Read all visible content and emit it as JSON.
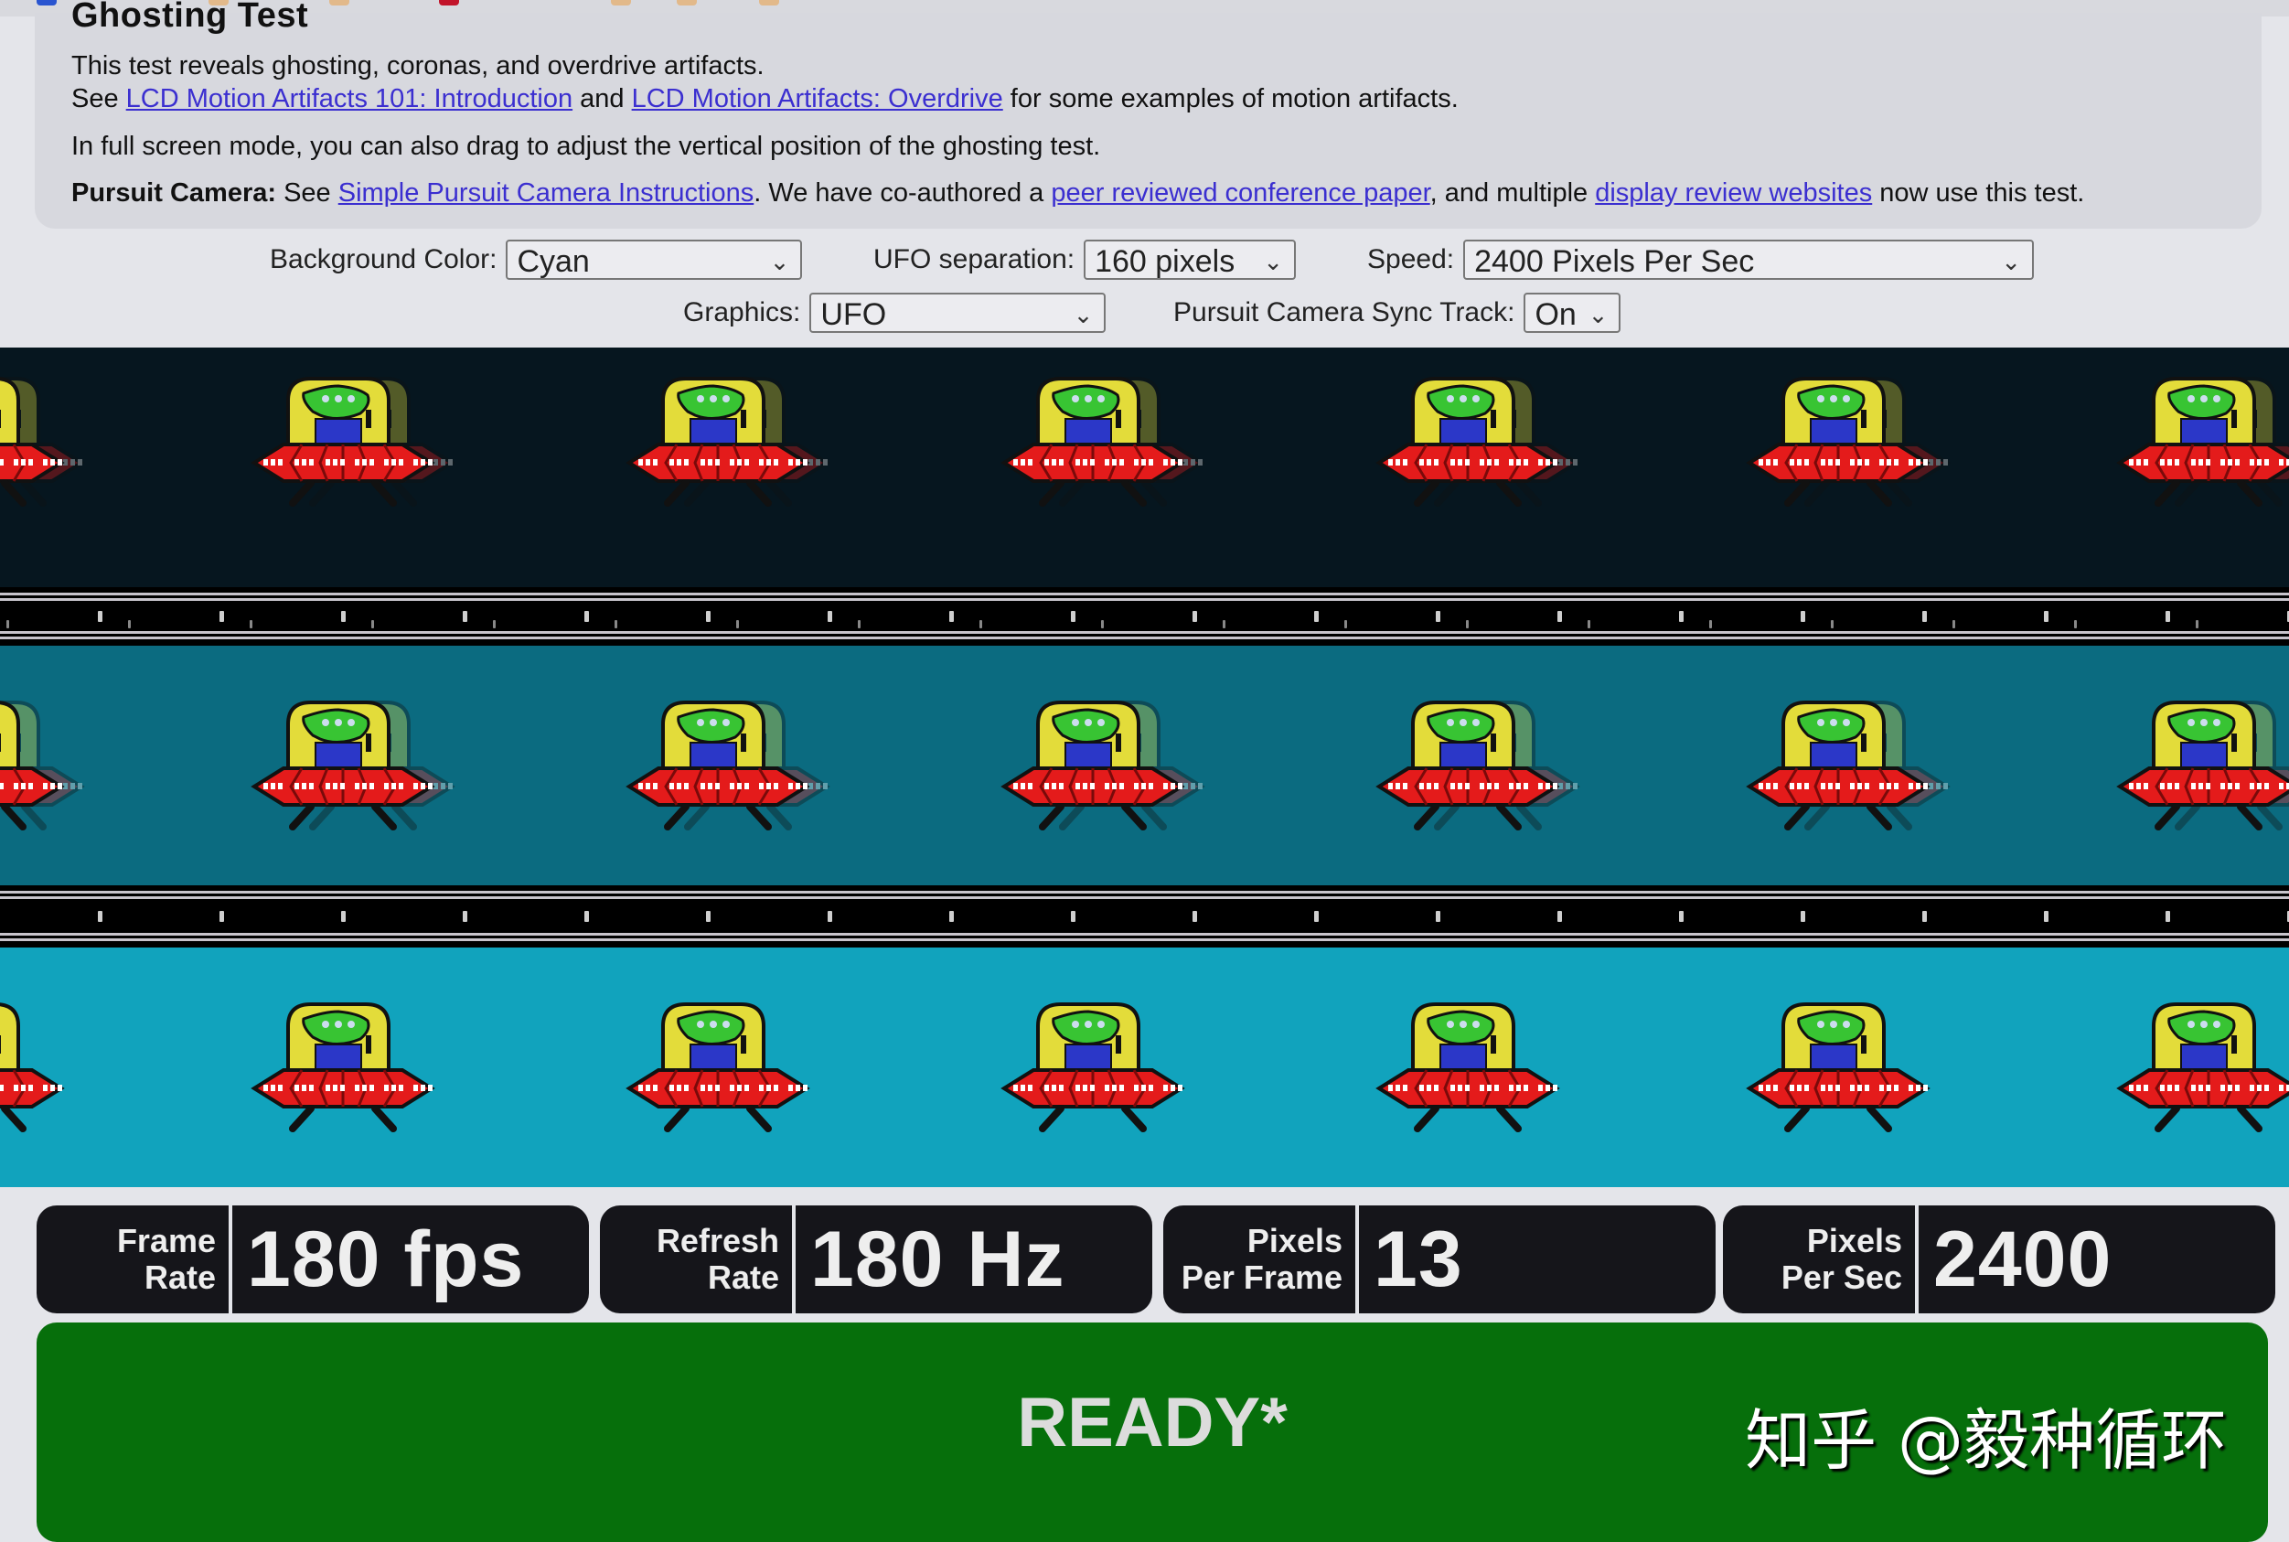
{
  "page": {
    "title": "Ghosting Test",
    "intro_line": "This test reveals ghosting, coronas, and overdrive artifacts.",
    "see_prefix": "See ",
    "link_intro": "LCD Motion Artifacts 101: Introduction",
    "and_word": " and ",
    "link_overdrive": "LCD Motion Artifacts: Overdrive",
    "see_suffix": " for some examples of motion artifacts.",
    "fullscreen_line": "In full screen mode, you can also drag to adjust the vertical position of the ghosting test.",
    "pursuit_label": "Pursuit Camera:",
    "pursuit_see": " See ",
    "link_pursuit": "Simple Pursuit Camera Instructions",
    "pursuit_mid": ". We have co-authored a ",
    "link_paper": "peer reviewed conference paper",
    "pursuit_mid2": ", and multiple ",
    "link_reviews": "display review websites",
    "pursuit_end": " now use this test."
  },
  "controls": {
    "background_color": {
      "label": "Background Color:",
      "value": "Cyan"
    },
    "ufo_separation": {
      "label": "UFO separation:",
      "value": "160 pixels"
    },
    "speed": {
      "label": "Speed:",
      "value": "2400 Pixels Per Sec"
    },
    "graphics": {
      "label": "Graphics:",
      "value": "UFO"
    },
    "sync_track": {
      "label": "Pursuit Camera Sync Track:",
      "value": "On"
    },
    "chevron": "⌄"
  },
  "lanes": [
    {
      "name": "dark",
      "color": "#06161f"
    },
    {
      "name": "medium",
      "color": "#0b6b80"
    },
    {
      "name": "light",
      "color": "#11a3bd"
    }
  ],
  "stats": [
    {
      "label_line1": "Frame",
      "label_line2": "Rate",
      "value": "180 fps"
    },
    {
      "label_line1": "Refresh",
      "label_line2": "Rate",
      "value": "180 Hz"
    },
    {
      "label_line1": "Pixels",
      "label_line2": "Per Frame",
      "value": "13"
    },
    {
      "label_line1": "Pixels",
      "label_line2": "Per Sec",
      "value": "2400"
    }
  ],
  "status": {
    "text": "READY*",
    "color": "#066f0b"
  },
  "watermark": "知乎 @毅种循环"
}
